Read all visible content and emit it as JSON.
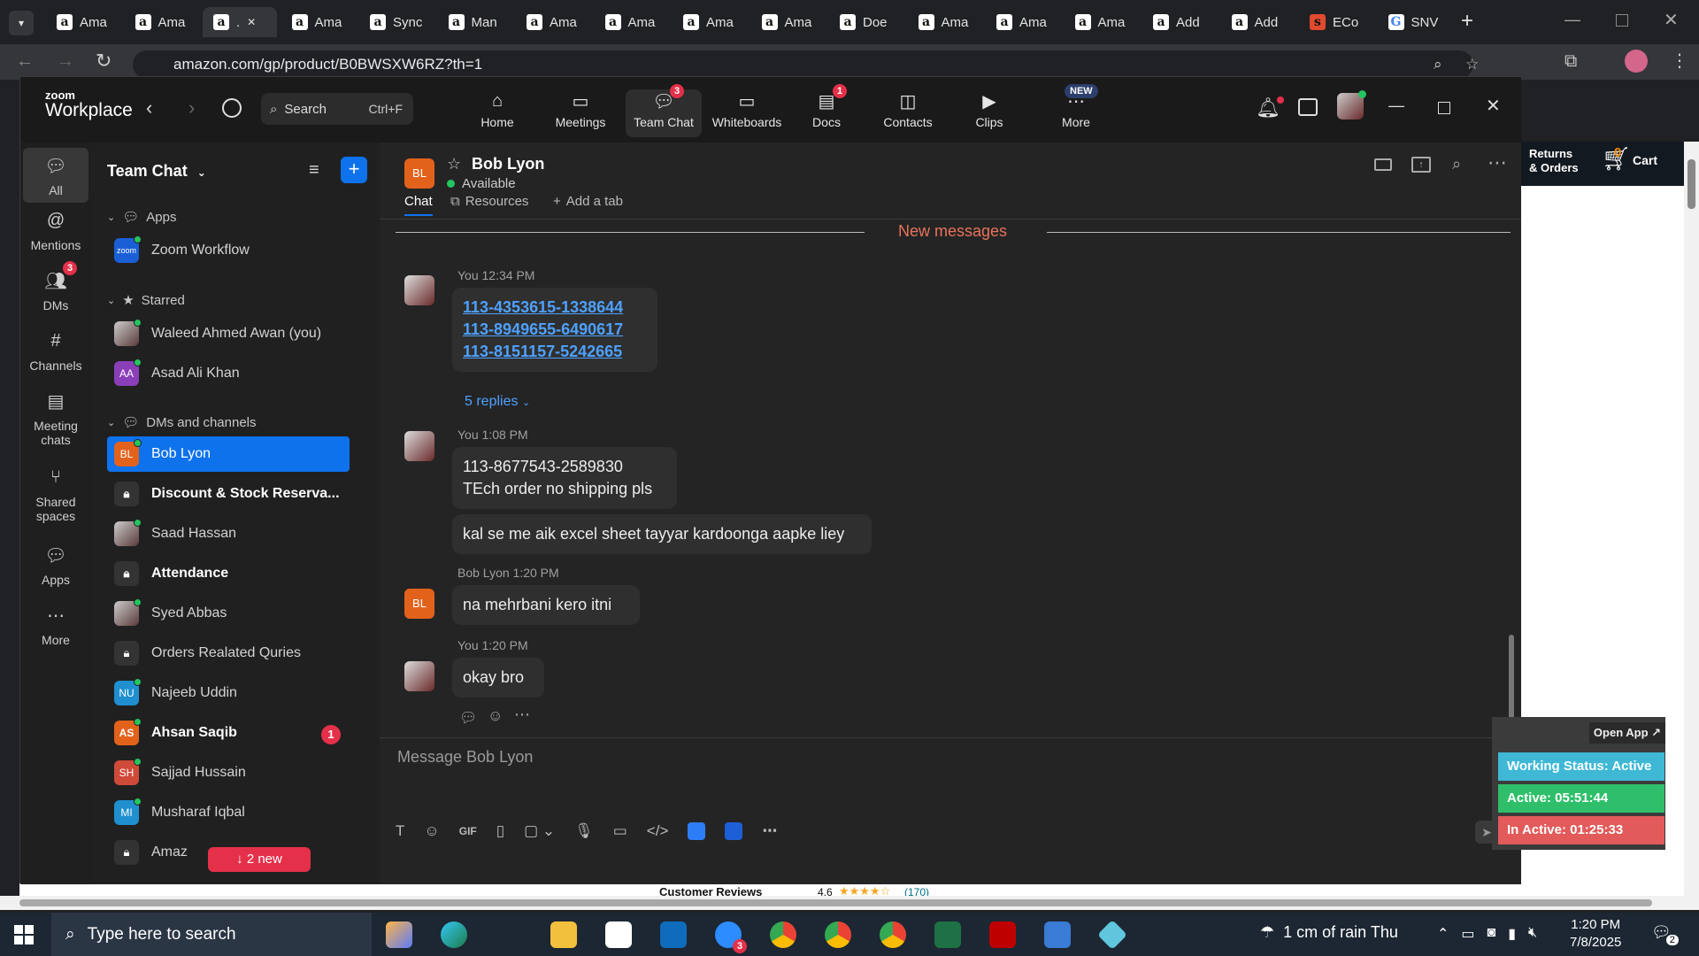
{
  "browser": {
    "tabs": [
      {
        "label": "Ama",
        "fav": "a"
      },
      {
        "label": "Ama",
        "fav": "a"
      },
      {
        "label": ".",
        "fav": "a",
        "active": true
      },
      {
        "label": "Ama",
        "fav": "a"
      },
      {
        "label": "Sync",
        "fav": "a"
      },
      {
        "label": "Man",
        "fav": "a"
      },
      {
        "label": "Ama",
        "fav": "a"
      },
      {
        "label": "Ama",
        "fav": "a"
      },
      {
        "label": "Ama",
        "fav": "a"
      },
      {
        "label": "Ama",
        "fav": "a"
      },
      {
        "label": "Doe",
        "fav": "a"
      },
      {
        "label": "Ama",
        "fav": "a"
      },
      {
        "label": "Ama",
        "fav": "a"
      },
      {
        "label": "Ama",
        "fav": "a"
      },
      {
        "label": "Add",
        "fav": "a"
      },
      {
        "label": "Add",
        "fav": "a"
      },
      {
        "label": "ECo",
        "fav": "s"
      },
      {
        "label": "SNV",
        "fav": "G"
      }
    ],
    "url": "amazon.com/gp/product/B0BWSXW6RZ?th=1"
  },
  "amazon": {
    "returns": "Returns",
    "orders": "& Orders",
    "cart_count": "0",
    "cart": "Cart",
    "reviews_label": "Customer Reviews",
    "rating": "4.6",
    "review_count": "(170)"
  },
  "zoom": {
    "brand_small": "zoom",
    "brand": "Workplace",
    "search_label": "Search",
    "search_shortcut": "Ctrl+F",
    "nav": [
      {
        "label": "Home",
        "icon": "home-icon"
      },
      {
        "label": "Meetings",
        "icon": "video-icon"
      },
      {
        "label": "Team Chat",
        "icon": "chat-icon",
        "badge": "3",
        "active": true
      },
      {
        "label": "Whiteboards",
        "icon": "whiteboard-icon"
      },
      {
        "label": "Docs",
        "icon": "docs-icon",
        "badge": "1"
      },
      {
        "label": "Contacts",
        "icon": "contacts-icon"
      },
      {
        "label": "Clips",
        "icon": "clips-icon"
      },
      {
        "label": "More",
        "icon": "more-icon",
        "tag": "NEW"
      }
    ],
    "rail": [
      {
        "label": "All",
        "active": true
      },
      {
        "label": "Mentions"
      },
      {
        "label": "DMs",
        "badge": "3"
      },
      {
        "label": "Channels"
      },
      {
        "label": "Meeting chats"
      },
      {
        "label": "Shared spaces"
      },
      {
        "label": "Apps"
      },
      {
        "label": "More"
      }
    ],
    "sidebar": {
      "title": "Team Chat",
      "sections": {
        "apps": "Apps",
        "starred": "Starred",
        "dms": "DMs and channels"
      },
      "apps_items": [
        {
          "label": "Zoom Workflow",
          "initials": "zoom"
        }
      ],
      "starred_items": [
        {
          "label": "Waleed Ahmed Awan (you)",
          "initials": ""
        },
        {
          "label": "Asad Ali Khan",
          "initials": "AA"
        }
      ],
      "dm_items": [
        {
          "label": "Bob Lyon",
          "initials": "BL",
          "selected": true
        },
        {
          "label": "Discount & Stock Reserva...",
          "locked": true,
          "bold": true
        },
        {
          "label": "Saad Hassan",
          "initials": ""
        },
        {
          "label": "Attendance",
          "locked": true,
          "bold": true
        },
        {
          "label": "Syed Abbas",
          "initials": ""
        },
        {
          "label": "Orders Realated Quries",
          "locked": true
        },
        {
          "label": "Najeeb Uddin",
          "initials": "NU"
        },
        {
          "label": "Ahsan Saqib",
          "initials": "AS",
          "bold": true,
          "badge": "1"
        },
        {
          "label": "Sajjad Hussain",
          "initials": "SH"
        },
        {
          "label": "Musharaf Iqbal",
          "initials": "MI"
        },
        {
          "label": "Amaz",
          "suffix": "m",
          "locked": true
        }
      ],
      "new_pill": "2 new"
    },
    "chat": {
      "contact_initials": "BL",
      "contact_name": "Bob Lyon",
      "contact_status": "Available",
      "tabs": [
        "Chat",
        "Resources",
        "Add a tab"
      ],
      "divider": "New messages",
      "messages": [
        {
          "author": "You",
          "time": "12:34 PM",
          "links": [
            "113-4353615-1338644",
            "113-8949655-6490617",
            "113-8151157-5242665"
          ],
          "replies": "5 replies"
        },
        {
          "author": "You",
          "time": "1:08 PM",
          "lines": [
            "113-8677543-2589830",
            "TEch order no shipping pls"
          ],
          "followup": "kal se me aik excel sheet tayyar kardoonga aapke liey"
        },
        {
          "author": "Bob Lyon",
          "time": "1:20 PM",
          "lines": [
            "na mehrbani kero itni"
          ]
        },
        {
          "author": "You",
          "time": "1:20 PM",
          "lines": [
            "okay bro"
          ]
        }
      ],
      "composer_placeholder": "Message Bob Lyon"
    }
  },
  "widget": {
    "open_app": "Open App ↗",
    "working": "Working Status: Active",
    "active": "Active: 05:51:44",
    "inactive": "In Active: 01:25:33"
  },
  "taskbar": {
    "search_placeholder": "Type here to search",
    "weather": "1 cm of rain Thu",
    "time": "1:20 PM",
    "date": "7/8/2025",
    "notif": "2",
    "zoom_badge": "3"
  },
  "colors": {
    "zoom_blue": "#0e72ed",
    "online": "#23c55e",
    "badge_red": "#e5304a",
    "link": "#4ea1ff",
    "new_msg": "#e8735a",
    "working": "#3fb8d6",
    "active": "#2fbf6a",
    "inactive": "#e25a5a"
  }
}
